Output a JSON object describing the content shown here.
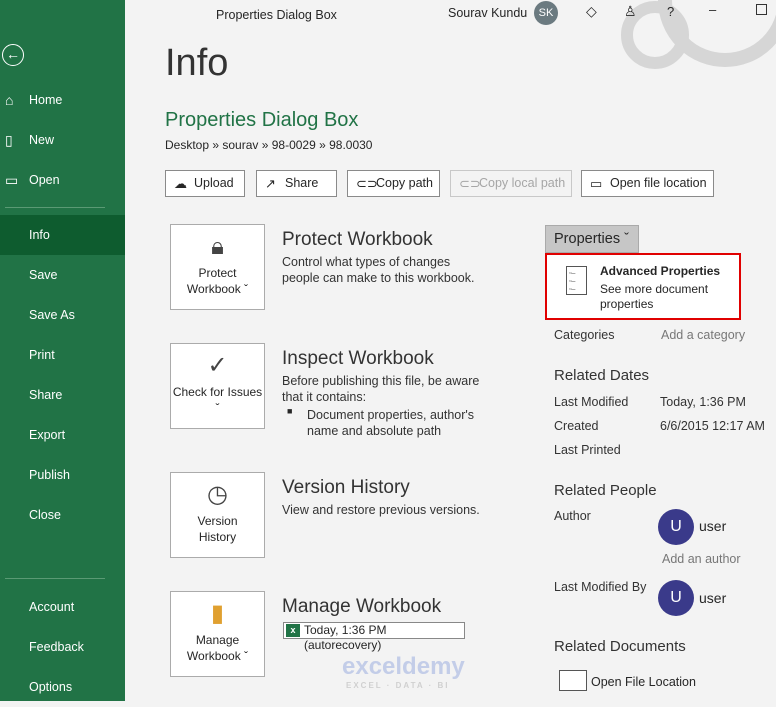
{
  "window": {
    "title": "Properties Dialog Box",
    "user": "Sourav Kundu",
    "initials": "SK"
  },
  "sidebar": {
    "items": [
      {
        "label": "Home"
      },
      {
        "label": "New"
      },
      {
        "label": "Open"
      },
      {
        "label": "Info"
      },
      {
        "label": "Save"
      },
      {
        "label": "Save As"
      },
      {
        "label": "Print"
      },
      {
        "label": "Share"
      },
      {
        "label": "Export"
      },
      {
        "label": "Publish"
      },
      {
        "label": "Close"
      },
      {
        "label": "Account"
      },
      {
        "label": "Feedback"
      },
      {
        "label": "Options"
      }
    ]
  },
  "main": {
    "heading": "Info",
    "doc_title": "Properties Dialog Box",
    "path": "Desktop » sourav » 98-0029 » 98.0030",
    "buttons": {
      "upload": "Upload",
      "share": "Share",
      "copy_path": "Copy path",
      "copy_local": "Copy local path",
      "open_loc": "Open file location"
    },
    "sections": [
      {
        "card": "Protect Workbook ˇ",
        "title": "Protect Workbook",
        "desc": "Control what types of changes people can make to this workbook."
      },
      {
        "card": "Check for Issues ˇ",
        "title": "Inspect Workbook",
        "desc": "Before publishing this file, be aware that it contains:",
        "bullet": "Document properties, author's name and absolute path"
      },
      {
        "card": "Version History",
        "title": "Version History",
        "desc": "View and restore previous versions."
      },
      {
        "card": "Manage Workbook ˇ",
        "title": "Manage Workbook",
        "version": "Today, 1:36 PM (autorecovery)"
      }
    ]
  },
  "properties": {
    "button": "Properties ˇ",
    "menu_title": "Advanced Properties",
    "menu_desc": "See more document properties",
    "categories_label": "Categories",
    "categories_value": "Add a category",
    "dates_heading": "Related Dates",
    "last_modified_label": "Last Modified",
    "last_modified": "Today, 1:36 PM",
    "created_label": "Created",
    "created": "6/6/2015 12:17 AM",
    "last_printed_label": "Last Printed",
    "people_heading": "Related People",
    "author_label": "Author",
    "author": "user",
    "avatar_letter": "U",
    "add_author": "Add an author",
    "modified_by_label": "Last Modified By",
    "modified_by": "user",
    "docs_heading": "Related Documents",
    "open_location": "Open File Location"
  },
  "watermark": {
    "name": "exceldemy",
    "tag": "EXCEL · DATA · BI"
  }
}
